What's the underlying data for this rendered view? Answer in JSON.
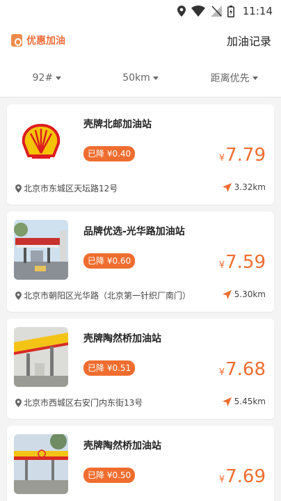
{
  "status_bar": {
    "time": "11:14"
  },
  "header": {
    "brand": "优惠加油",
    "records": "加油记录"
  },
  "filters": [
    {
      "label": "92#"
    },
    {
      "label": "50km"
    },
    {
      "label": "距离优先"
    }
  ],
  "stations": [
    {
      "name": "壳牌北邮加油站",
      "discount": "已降 ¥0.40",
      "currency": "¥",
      "price": "7.79",
      "address": "北京市东城区天坛路12号",
      "distance": "3.32km",
      "thumb": "shell-logo"
    },
    {
      "name": "品牌优选-光华路加油站",
      "discount": "已降 ¥0.60",
      "currency": "¥",
      "price": "7.59",
      "address": "北京市朝阳区光华路（北京第一针织厂南门）",
      "distance": "5.30km",
      "thumb": "station-photo"
    },
    {
      "name": "壳牌陶然桥加油站",
      "discount": "已降 ¥0.51",
      "currency": "¥",
      "price": "7.68",
      "address": "北京市西城区右安门内东街13号",
      "distance": "5.45km",
      "thumb": "station-photo"
    },
    {
      "name": "壳牌陶然桥加油站",
      "discount": "已降 ¥0.50",
      "currency": "¥",
      "price": "7.69",
      "address": "",
      "distance": "",
      "thumb": "station-photo"
    }
  ],
  "colors": {
    "accent": "#ef6d2f",
    "brand": "#ef6d3b"
  }
}
